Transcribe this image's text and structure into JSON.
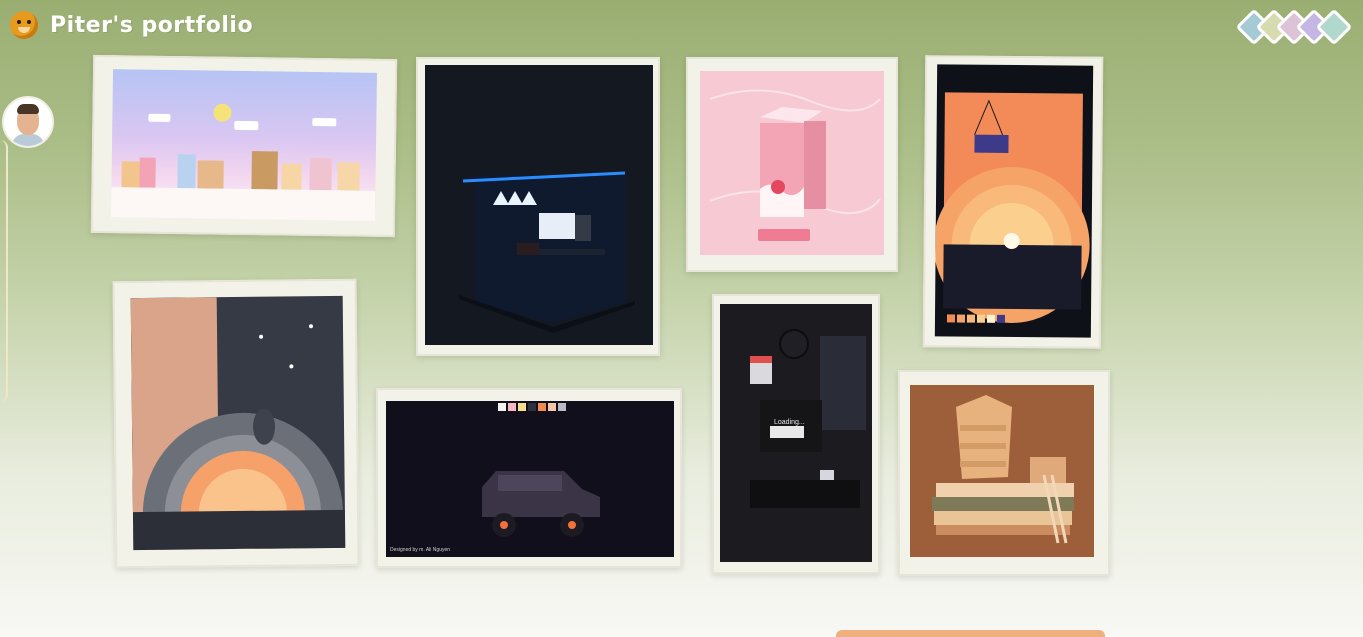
{
  "header": {
    "title": "Piter's portfolio",
    "logo_icon": "monkey-face-icon"
  },
  "menu": {
    "icon": "diamond-stack-menu-icon",
    "colors": [
      "#7fb9c9",
      "#c7d7a2",
      "#e0c3d6",
      "#c1b4e4",
      "#9fd1c6"
    ]
  },
  "profile": {
    "avatar_icon": "profile-avatar-icon"
  },
  "gallery": {
    "artworks": [
      {
        "name": "pastel-town-artwork"
      },
      {
        "name": "gaming-room-artwork"
      },
      {
        "name": "strawberry-milk-artwork"
      },
      {
        "name": "sunset-plant-artwork"
      },
      {
        "name": "night-balloon-artwork"
      },
      {
        "name": "offroad-car-artwork",
        "credit": "Designed by m. Ali Nguyen"
      },
      {
        "name": "loading-screen-artwork",
        "screen_text": "Loading..."
      },
      {
        "name": "book-shelf-artwork"
      }
    ]
  },
  "footer": {
    "bar_color": "#f0b07e"
  }
}
